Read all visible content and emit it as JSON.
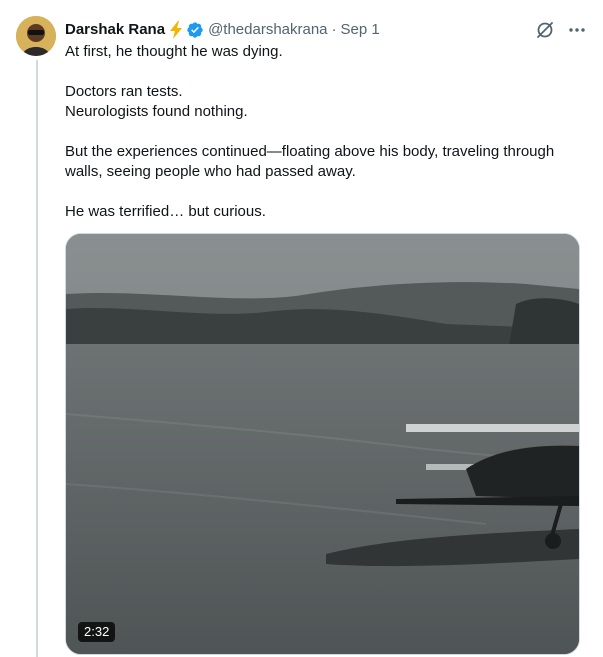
{
  "tweet": {
    "author_name": "Darshak Rana",
    "author_badge_icon": "lightning-emoji",
    "verified_icon": "verified-badge",
    "handle": "@thedarshakrana",
    "separator": "·",
    "date": "Sep 1",
    "paragraphs": [
      [
        "At first, he thought he was dying."
      ],
      [
        "Doctors ran tests.",
        "Neurologists found nothing."
      ],
      [
        "But the experiences continued—floating above his body, traveling through walls, seeing people who had passed away."
      ],
      [
        "He was terrified… but curious."
      ]
    ],
    "media": {
      "type": "video",
      "duration": "2:32"
    }
  },
  "colors": {
    "text_primary": "#0f1419",
    "text_secondary": "#536471",
    "verified_blue": "#1d9bf0",
    "bolt_yellow": "#f4b400",
    "thread_line": "#cfd9de"
  }
}
